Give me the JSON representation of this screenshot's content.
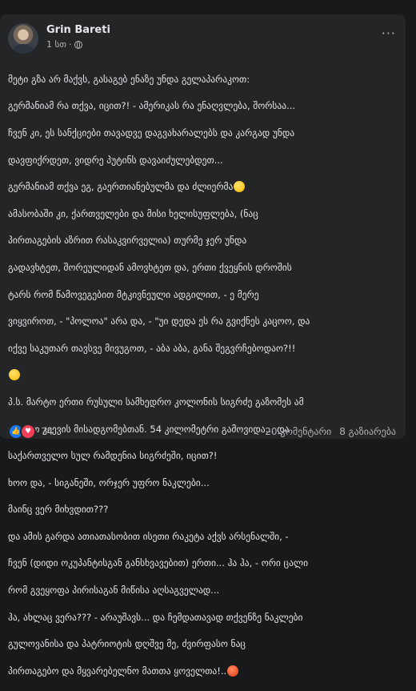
{
  "post": {
    "author": "Grin Bareti",
    "time": "1 სთ",
    "time_sep": "·",
    "more_glyph": "···",
    "lines": [
      "მეტი გზა არ მაქვს, გასაგებ ენაზე უნდა გელაპარაკოთ:",
      "გერმანიამ რა თქვა, იცით?! - ამერიკას რა ენაღვლება, შორსაა...",
      "ჩვენ კი, ეს სანქციები თავადვე დაგვახარალებს და კარგად უნდა",
      "დავფიქრდეთ, ვიდრე პუტინს დავაიძულებდეთ...",
      "გერმანიამ თქვა ეგ, გაერთიანებულმა და ძლიერმა",
      "ამასობაში კი, ქართველები და მისი ხელისუფლება, (ნაც",
      "პირთაგების აზრით რასაკვირველია) თურმე ჯერ უნდა",
      "გადავხტეთ, შორეულიდან ამოვხტეთ და, ერთი ქვეყნის დროშის",
      "ტარს რომ წამოვეგებით მტკივნეული ადგილით, - ე მერე",
      "ვიყვიროთ, - \"პოლოა\" არა და, - \"უი დედა ეს რა გვიქნეს კაცოო, და",
      "იქვე საკუთარ თავსვე მივუგოთ, - აბა აბა, განა შეგვრჩებოდაო?!!",
      "",
      "პ.ს. მარტო ერთი რუსული სამხედრო კოლონის სიგრძე გაზომეს ამ",
      "დღიეთ კიევის მისადგომებთან. 54 კილომეტრი გამოვიდა... და",
      "საქართველო სულ რამდენია სიგრძეში, იცით?!",
      "ხოო და, - სიგანეში, ორჯერ უფრო ნაკლები...",
      "მაინც ვერ მიხვდით???",
      "და ამის გარდა ათიათასობით ისეთი რაკეტა აქვს არსენალში, -",
      "ჩვენ (დიდი ოკუპანტისგან განსხვავებით) ერთი... ჰა ჰა, - ორი ცალი",
      "რომ გვეყოფა პირისაგან მიწისა აღსაგველად...",
      "ჰა, ახლაც ვერა??? - არაუშავს... და ჩემდათავად თქვენზე ნაკლები",
      "გულოვანისა და პატრიოტის დღშვე მე, ძვირფასო ნაც",
      "პირთაგებო და მყვარებელნო მათთა ყოველთა!.."
    ],
    "emoji": {
      "line4": "thinking-face-emoji",
      "line11": "sad-face-emoji",
      "line22": "angry-face-emoji"
    },
    "reactions_count": "74",
    "comments": "20 კომენტარი",
    "shares": "8 გაზიარება"
  }
}
